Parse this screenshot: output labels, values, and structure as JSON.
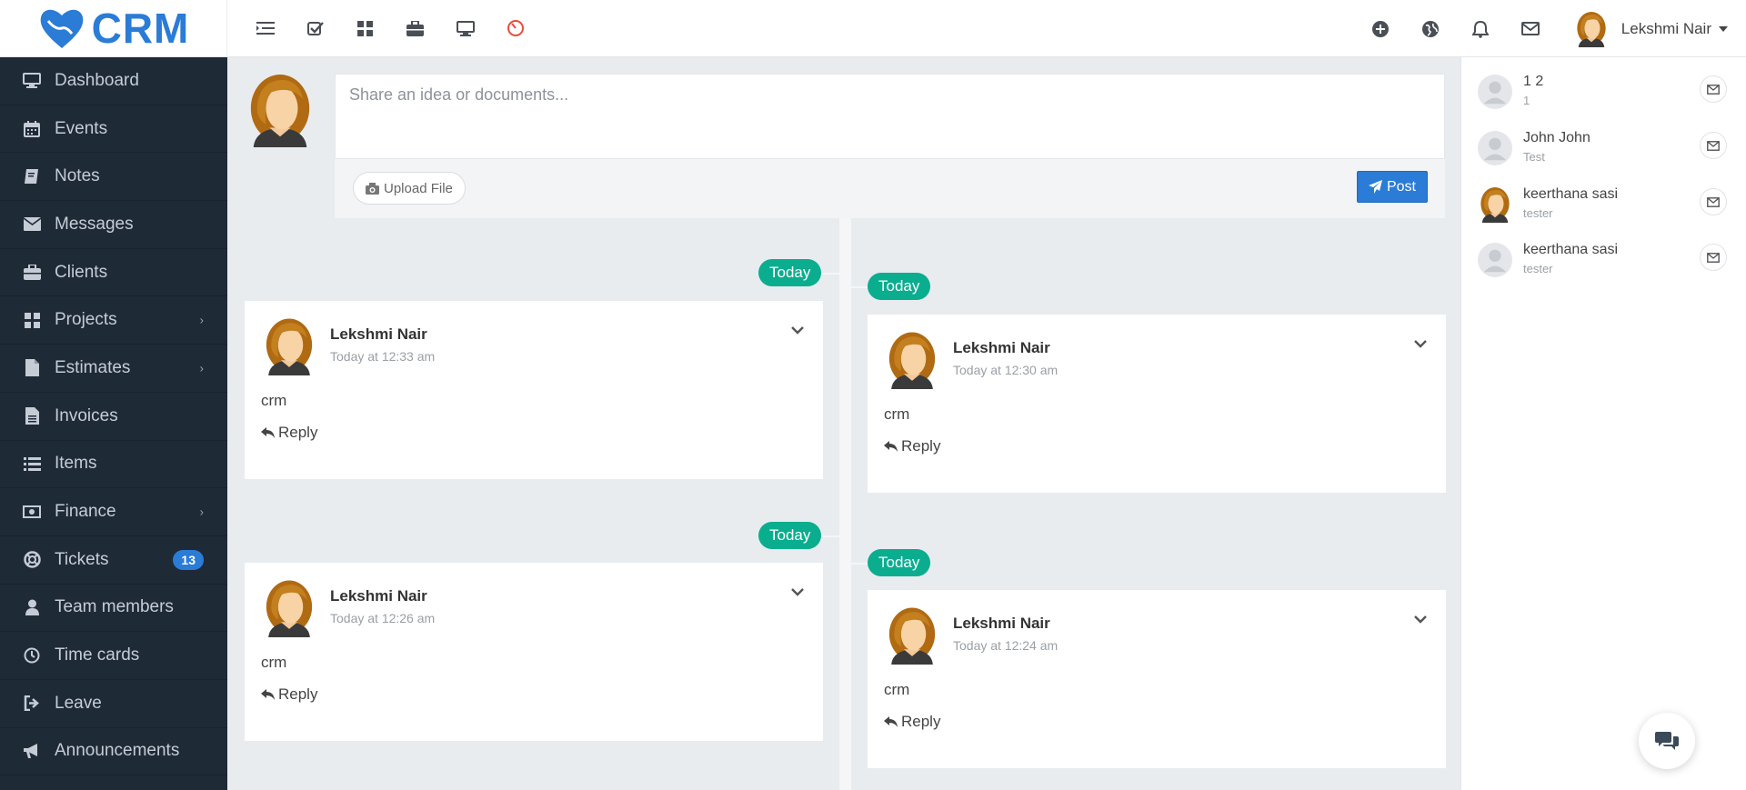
{
  "app": {
    "logo_text": "CRM",
    "brand_color": "#2a7cd6"
  },
  "topbar": {
    "left_icons": [
      "list-icon",
      "checkbox-icon",
      "grid-icon",
      "briefcase-icon",
      "monitor-icon",
      "clock-icon"
    ],
    "right_icons": [
      "plus-circle-icon",
      "globe-icon",
      "bell-icon",
      "envelope-icon"
    ],
    "user_name": "Lekshmi Nair"
  },
  "sidebar": {
    "items": [
      {
        "label": "Dashboard",
        "icon": "monitor-icon"
      },
      {
        "label": "Events",
        "icon": "calendar-icon"
      },
      {
        "label": "Notes",
        "icon": "book-icon"
      },
      {
        "label": "Messages",
        "icon": "envelope-icon"
      },
      {
        "label": "Clients",
        "icon": "briefcase-icon"
      },
      {
        "label": "Projects",
        "icon": "grid-icon",
        "arrow": "›"
      },
      {
        "label": "Estimates",
        "icon": "file-icon",
        "arrow": "›"
      },
      {
        "label": "Invoices",
        "icon": "file-text-icon"
      },
      {
        "label": "Items",
        "icon": "list-icon"
      },
      {
        "label": "Finance",
        "icon": "money-icon",
        "arrow": "›"
      },
      {
        "label": "Tickets",
        "icon": "lifebuoy-icon",
        "badge": "13"
      },
      {
        "label": "Team members",
        "icon": "user-icon"
      },
      {
        "label": "Time cards",
        "icon": "clock-icon"
      },
      {
        "label": "Leave",
        "icon": "sign-out-icon"
      },
      {
        "label": "Announcements",
        "icon": "bullhorn-icon"
      }
    ]
  },
  "composer": {
    "placeholder": "Share an idea or documents...",
    "upload_label": "Upload File",
    "post_label": "Post"
  },
  "timeline": {
    "date_labels": [
      "Today",
      "Today",
      "Today",
      "Today"
    ],
    "posts": [
      {
        "author": "Lekshmi Nair",
        "time": "Today at 12:33 am",
        "text": "crm",
        "reply_label": "Reply"
      },
      {
        "author": "Lekshmi Nair",
        "time": "Today at 12:30 am",
        "text": "crm",
        "reply_label": "Reply"
      },
      {
        "author": "Lekshmi Nair",
        "time": "Today at 12:26 am",
        "text": "crm",
        "reply_label": "Reply"
      },
      {
        "author": "Lekshmi Nair",
        "time": "Today at 12:24 am",
        "text": "crm",
        "reply_label": "Reply"
      }
    ]
  },
  "contacts": [
    {
      "name": "1 2",
      "subtitle": "1",
      "avatar": "placeholder"
    },
    {
      "name": "John John",
      "subtitle": "Test",
      "avatar": "placeholder"
    },
    {
      "name": "keerthana sasi",
      "subtitle": "tester",
      "avatar": "photo"
    },
    {
      "name": "keerthana sasi",
      "subtitle": "tester",
      "avatar": "placeholder"
    }
  ]
}
